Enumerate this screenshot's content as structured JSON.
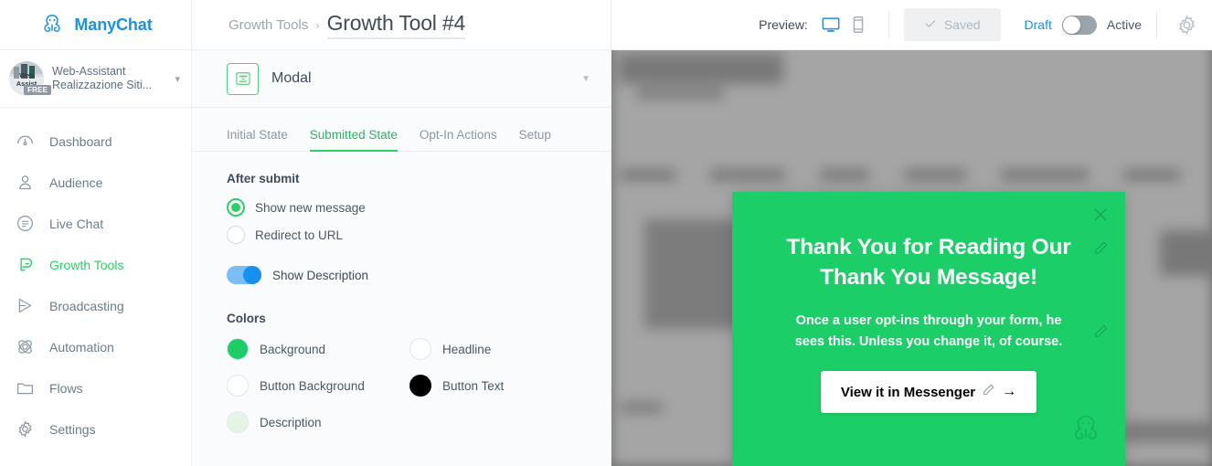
{
  "brand": {
    "name": "ManyChat",
    "logo_icon": "manychat-octopus-logo"
  },
  "account": {
    "line1": "Web-Assistant",
    "line2": "Realizzazione Siti...",
    "badge": "FREE",
    "avatar_text": "Web Assist",
    "chevron_icon": "chevron-down-icon"
  },
  "sidebar": {
    "items": [
      {
        "label": "Dashboard",
        "icon": "dashboard-gauge-icon",
        "active": false
      },
      {
        "label": "Audience",
        "icon": "person-icon",
        "active": false
      },
      {
        "label": "Live Chat",
        "icon": "chat-bubble-icon",
        "active": false
      },
      {
        "label": "Growth Tools",
        "icon": "magnet-icon",
        "active": true
      },
      {
        "label": "Broadcasting",
        "icon": "send-paper-plane-icon",
        "active": false
      },
      {
        "label": "Automation",
        "icon": "atom-icon",
        "active": false
      },
      {
        "label": "Flows",
        "icon": "folder-icon",
        "active": false
      },
      {
        "label": "Settings",
        "icon": "gear-icon",
        "active": false
      }
    ]
  },
  "header": {
    "breadcrumb_parent": "Growth Tools",
    "breadcrumb_sep": "›",
    "title": "Growth Tool #4",
    "preview_label": "Preview:",
    "desktop_icon": "desktop-monitor-icon",
    "mobile_icon": "mobile-device-icon",
    "saved_label": "Saved",
    "saved_check_icon": "check-icon",
    "state_draft": "Draft",
    "state_active": "Active",
    "settings_icon": "gear-icon"
  },
  "editor": {
    "type_label": "Modal",
    "type_icon": "modal-window-icon",
    "type_caret_icon": "chevron-down-icon",
    "tabs": [
      {
        "label": "Initial State",
        "active": false
      },
      {
        "label": "Submitted State",
        "active": true
      },
      {
        "label": "Opt-In Actions",
        "active": false
      },
      {
        "label": "Setup",
        "active": false
      }
    ],
    "after_submit": {
      "title": "After submit",
      "options": [
        {
          "label": "Show new message",
          "selected": true
        },
        {
          "label": "Redirect to URL",
          "selected": false
        }
      ]
    },
    "show_description": {
      "label": "Show Description",
      "on": true
    },
    "colors": {
      "title": "Colors",
      "items": [
        {
          "label": "Background",
          "value": "#1bce67"
        },
        {
          "label": "Headline",
          "value": "#ffffff"
        },
        {
          "label": "Button Background",
          "value": "#ffffff"
        },
        {
          "label": "Button Text",
          "value": "#000000"
        },
        {
          "label": "Description",
          "value": "#e4f5e8"
        }
      ]
    }
  },
  "modal_preview": {
    "headline": "Thank You for Reading Our Thank You Message!",
    "description": "Once a user opt-ins through your form, he sees this. Unless you change it, of course.",
    "button_label": "View it in Messenger",
    "button_arrow": "→",
    "close_icon": "close-x-icon",
    "edit_headline_icon": "pencil-edit-icon",
    "edit_description_icon": "pencil-edit-icon",
    "edit_button_icon": "pencil-edit-icon",
    "watermark_icon": "manychat-octopus-logo",
    "background_color": "#1bce67"
  }
}
